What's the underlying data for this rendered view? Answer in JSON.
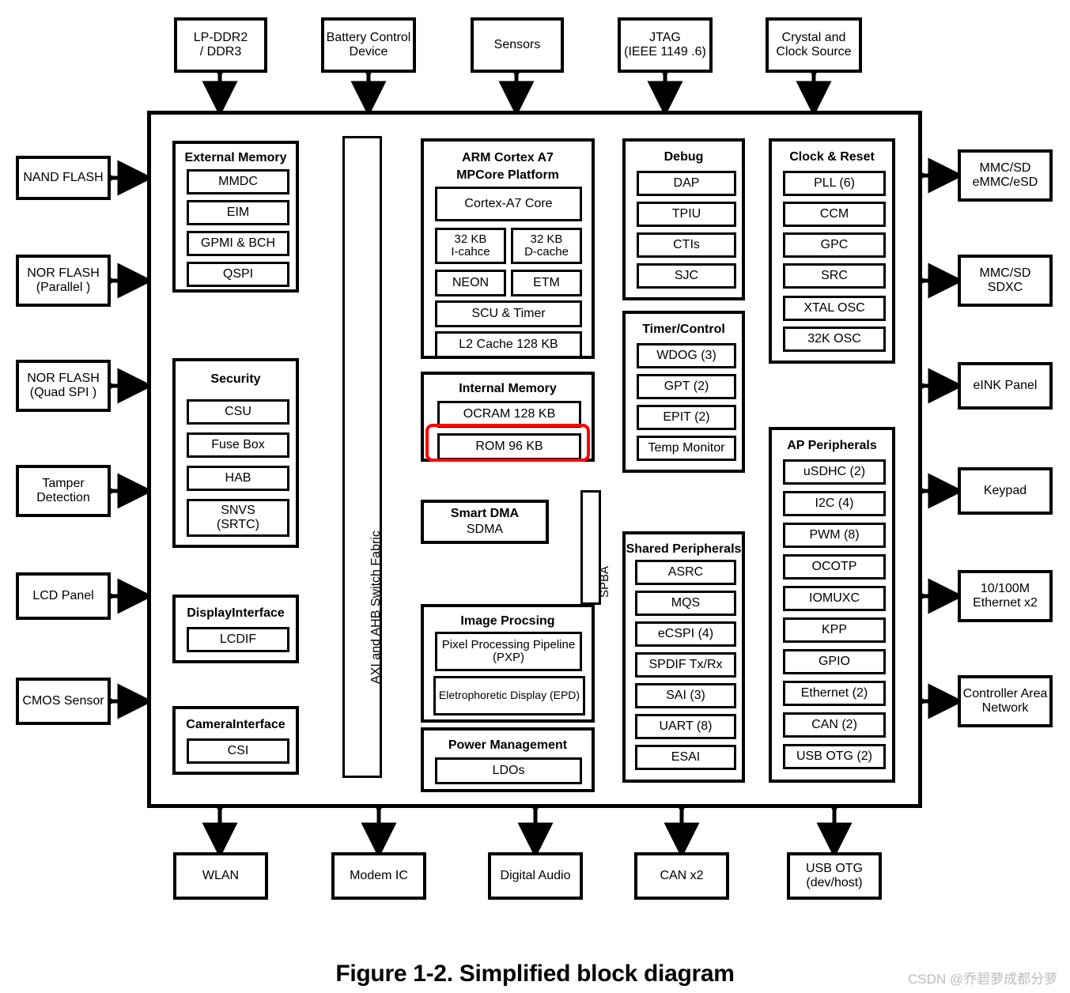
{
  "figure": {
    "caption": "Figure 1-2. Simplified block diagram",
    "watermark": "CSDN @乔碧萝成都分萝",
    "highlight_color": "#ff0000",
    "highlighted_block": "ROM 96 KB"
  },
  "top_peripherals": [
    {
      "label": "LP-DDR2\n/ DDR3"
    },
    {
      "label": "Battery Control\nDevice"
    },
    {
      "label": "Sensors"
    },
    {
      "label": "JTAG\n(IEEE 1149 .6)"
    },
    {
      "label": "Crystal and\nClock Source"
    }
  ],
  "bottom_peripherals": [
    {
      "label": "WLAN"
    },
    {
      "label": "Modem IC"
    },
    {
      "label": "Digital Audio"
    },
    {
      "label": "CAN x2"
    },
    {
      "label": "USB OTG\n(dev/host)"
    }
  ],
  "left_peripherals": [
    {
      "label": "NAND FLASH"
    },
    {
      "label": "NOR FLASH\n(Parallel )"
    },
    {
      "label": "NOR FLASH\n(Quad SPI )"
    },
    {
      "label": "Tamper\nDetection"
    },
    {
      "label": "LCD Panel"
    },
    {
      "label": "CMOS Sensor"
    }
  ],
  "right_peripherals": [
    {
      "label": "MMC/SD\neMMC/eSD"
    },
    {
      "label": "MMC/SD\nSDXC"
    },
    {
      "label": "eINK Panel"
    },
    {
      "label": "Keypad"
    },
    {
      "label": "10/100M\nEthernet x2"
    },
    {
      "label": "Controller Area\nNetwork"
    }
  ],
  "bus": {
    "axi_label": "AXI and AHB Switch Fabric",
    "spba_label": "SPBA"
  },
  "groups": {
    "external_memory": {
      "title": "External Memory",
      "items": [
        "MMDC",
        "EIM",
        "GPMI & BCH",
        "QSPI"
      ]
    },
    "security": {
      "title": "Security",
      "items": [
        "CSU",
        "Fuse Box",
        "HAB",
        "SNVS\n(SRTC)"
      ]
    },
    "display_interface": {
      "title": "DisplayInterface",
      "items": [
        "LCDIF"
      ]
    },
    "camera_interface": {
      "title": "CameraInterface",
      "items": [
        "CSI"
      ]
    },
    "arm_core": {
      "title": "ARM Cortex A7\nMPCore Platform",
      "items": [
        "Cortex-A7 Core",
        "32 KB\nI-cahce",
        "32 KB\nD-cache",
        "NEON",
        "ETM",
        "SCU & Timer",
        "L2 Cache 128 KB"
      ]
    },
    "internal_memory": {
      "title": "Internal Memory",
      "items": [
        "OCRAM 128 KB",
        "ROM 96 KB"
      ]
    },
    "smart_dma": {
      "title": "Smart DMA",
      "subtitle": "SDMA"
    },
    "image_processing": {
      "title": "Image Procsing",
      "items": [
        "Pixel Processing Pipeline\n(PXP)",
        "Eletrophoretic Display (EPD)"
      ]
    },
    "power_management": {
      "title": "Power Management",
      "items": [
        "LDOs"
      ]
    },
    "debug": {
      "title": "Debug",
      "items": [
        "DAP",
        "TPIU",
        "CTIs",
        "SJC"
      ]
    },
    "timer_control": {
      "title": "Timer/Control",
      "items": [
        "WDOG (3)",
        "GPT (2)",
        "EPIT (2)",
        "Temp Monitor"
      ]
    },
    "shared_peripherals": {
      "title": "Shared Peripherals",
      "items": [
        "ASRC",
        "MQS",
        "eCSPI (4)",
        "SPDIF Tx/Rx",
        "SAI (3)",
        "UART  (8)",
        "ESAI"
      ]
    },
    "clock_reset": {
      "title": "Clock & Reset",
      "items": [
        "PLL (6)",
        "CCM",
        "GPC",
        "SRC",
        "XTAL OSC",
        "32K OSC"
      ]
    },
    "ap_peripherals": {
      "title": "AP Peripherals",
      "items": [
        "uSDHC (2)",
        "I2C (4)",
        "PWM (8)",
        "OCOTP",
        "IOMUXC",
        "KPP",
        "GPIO",
        "Ethernet (2)",
        "CAN (2)",
        "USB OTG (2)"
      ]
    }
  }
}
